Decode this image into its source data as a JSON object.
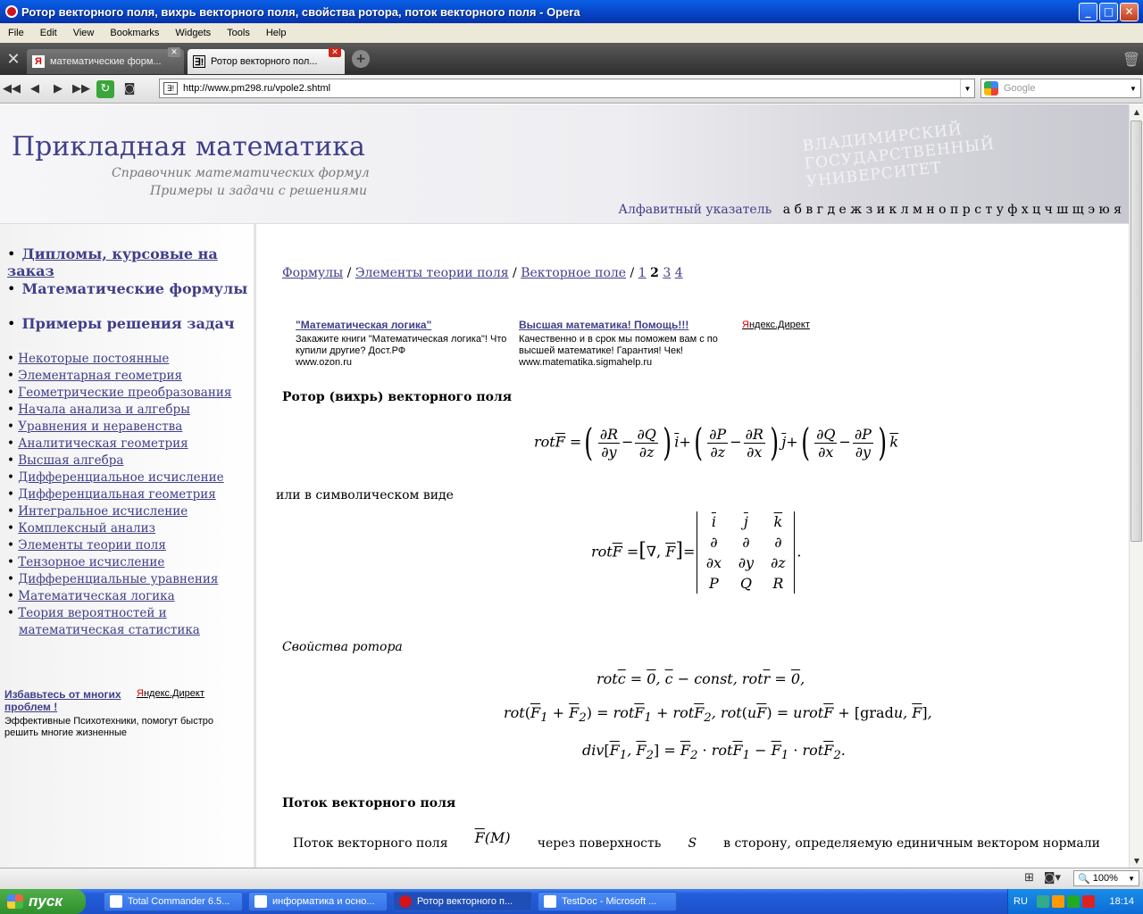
{
  "window": {
    "title": "Ротор векторного поля, вихрь векторного поля, свойства ротора, поток векторного поля - Opera",
    "min": "_",
    "max": "□",
    "close": "✕"
  },
  "menu": [
    "File",
    "Edit",
    "View",
    "Bookmarks",
    "Widgets",
    "Tools",
    "Help"
  ],
  "tabs": [
    {
      "favicon": "Я",
      "label": "математические форм..."
    },
    {
      "favicon": "∃!",
      "label": "Ротор векторного пол..."
    }
  ],
  "address": {
    "favicon": "∃!",
    "url": "http://www.pm298.ru/vpole2.shtml"
  },
  "search": {
    "placeholder": "Google"
  },
  "site": {
    "title": "Прикладная математика",
    "subtitle1": "Справочник математических формул",
    "subtitle2": "Примеры и задачи с решениями",
    "watermark": "ВЛАДИМИРСКИЙ ГОСУДАРСТВЕННЫЙ УНИВЕРСИТЕТ",
    "alpha_label": "Алфавитный указатель",
    "alpha_letters": "а б в г д е ж з и к л м н о п р с т у ф х ц ч ш щ э ю я"
  },
  "sidebar": {
    "big": [
      "Дипломы, курсовые на заказ",
      "Математические формулы",
      "Примеры решения задач"
    ],
    "small": [
      "Некоторые постоянные",
      "Элементарная геометрия",
      "Геометрические преобразования",
      "Начала анализа и алгебры",
      "Уравнения и неравенства",
      "Аналитическая геометрия",
      "Высшая алгебра",
      "Дифференциальное исчисление",
      "Дифференциальная геометрия",
      "Интегральное исчисление",
      "Комплексный анализ",
      "Элементы теории поля",
      "Тензорное исчисление",
      "Дифференциальные уравнения",
      "Математическая логика",
      "Теория вероятностей и",
      "математическая статистика"
    ],
    "ad": {
      "title": "Избавьтесь от многих проблем !",
      "text": "Эффективные Психотехники, помогут быстро решить многие жизненные",
      "direct": "ндекс.Директ",
      "direct_y": "Я"
    }
  },
  "main": {
    "crumbs": {
      "c1": "Формулы",
      "c2": "Элементы теории поля",
      "c3": "Векторное поле",
      "p1": "1",
      "p2": "2",
      "p3": "3",
      "p4": "4",
      "sep": " / "
    },
    "ads": [
      {
        "title": "\"Математическая логика\"",
        "text": "Закажите книги \"Математическая логика\"! Что купили другие? Дост.РФ",
        "url": "www.ozon.ru"
      },
      {
        "title": "Высшая математика! Помощь!!!",
        "text": "Качественно и в срок мы поможем вам с по высшей математике! Гарантия! Чек!",
        "url": "www.matematika.sigmahelp.ru"
      }
    ],
    "ads_direct_y": "Я",
    "ads_direct": "ндекс.Директ",
    "heading1": "Ротор (вихрь) векторного поля",
    "symbolic": "или в символическом виде",
    "props": "Свойства ротора",
    "heading2": "Поток векторного поля",
    "flux_text": "Поток векторного поля",
    "flux_rest": "через поверхность",
    "flux_S": "S",
    "flux_tail": "в сторону, определяемую единичным вектором нормали"
  },
  "status": {
    "zoom": "100%"
  },
  "taskbar": {
    "start": "пуск",
    "tasks": [
      "Total Commander 6.5...",
      "информатика и осно...",
      "Ротор векторного п...",
      "TestDoc - Microsoft ..."
    ],
    "lang": "RU",
    "clock": "18:14"
  }
}
